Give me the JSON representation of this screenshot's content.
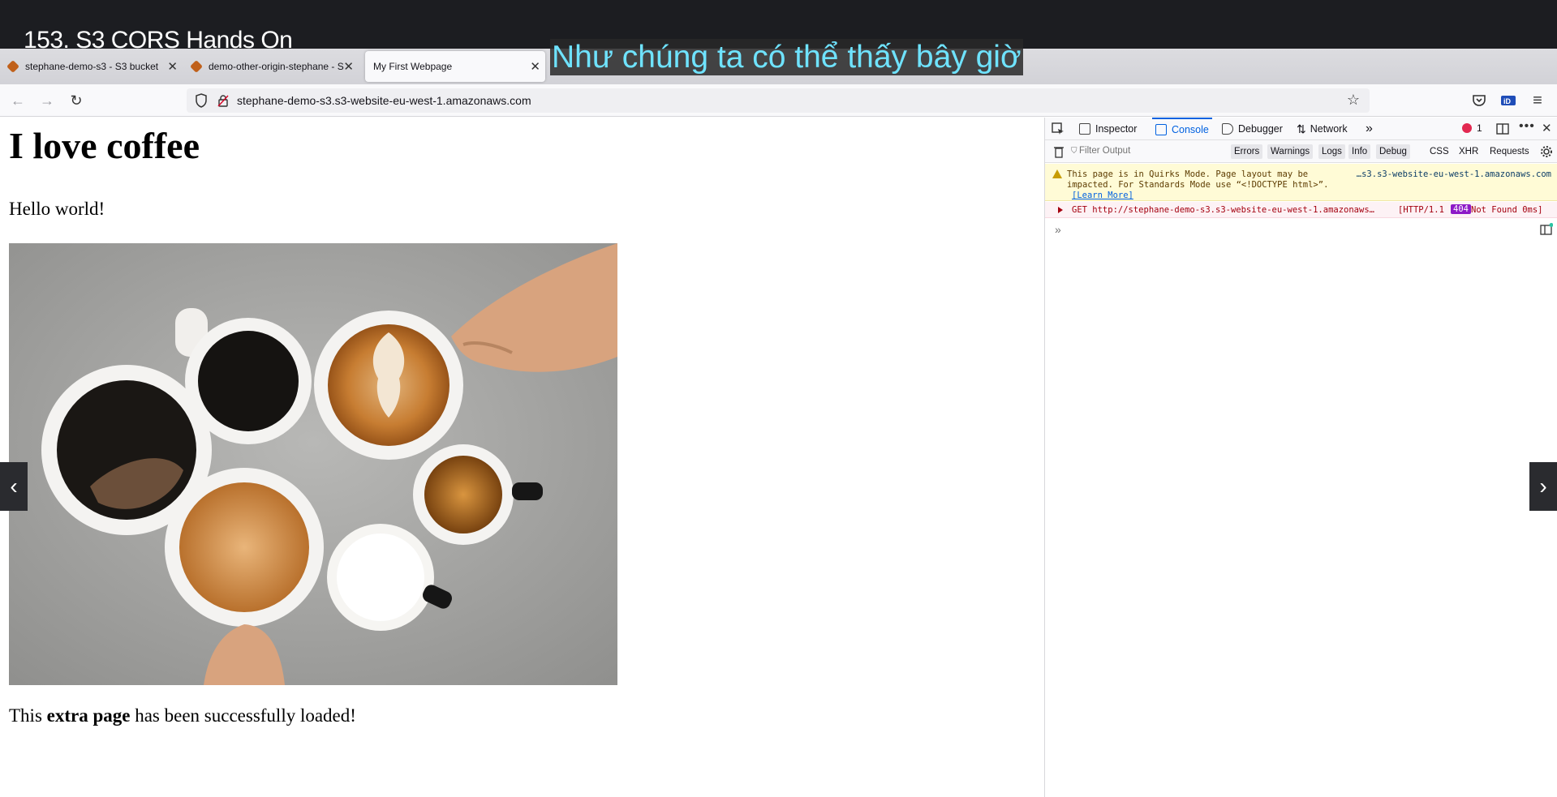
{
  "overlay": {
    "video_title": "153. S3 CORS Hands On",
    "subtitle": "Như chúng ta có thể thấy bây giờ"
  },
  "tabs": [
    {
      "label": "stephane-demo-s3 - S3 bucket",
      "close": "✕"
    },
    {
      "label": "demo-other-origin-stephane - S",
      "close": "✕"
    },
    {
      "label": "My First Webpage",
      "close": "✕"
    }
  ],
  "nav": {
    "back": "←",
    "forward": "→",
    "reload": "↻",
    "url": "stephane-demo-s3.s3-website-eu-west-1.amazonaws.com",
    "star": "☆",
    "menu": "≡"
  },
  "page": {
    "heading": "I love coffee",
    "hello": "Hello world!",
    "loaded_prefix": "This ",
    "loaded_bold": "extra page",
    "loaded_suffix": " has been successfully loaded!"
  },
  "side_arrows": {
    "left": "‹",
    "right": "›"
  },
  "devtools": {
    "tabs": [
      "Inspector",
      "Console",
      "Debugger",
      "Network"
    ],
    "more": "»",
    "error_count": "1",
    "filter_placeholder": "Filter Output",
    "filter_buttons": [
      "Errors",
      "Warnings",
      "Logs",
      "Info",
      "Debug"
    ],
    "filter_plain": [
      "CSS",
      "XHR",
      "Requests"
    ],
    "warning": {
      "line1": "This page is in Quirks Mode. Page layout may be",
      "line2": "impacted. For Standards Mode use “<!DOCTYPE html>”.",
      "link": "[Learn More]",
      "source": "…s3.s3-website-eu-west-1.amazonaws.com"
    },
    "error": {
      "request": "GET http://stephane-demo-s3.s3-website-eu-west-1.amazonaws…",
      "http": "[HTTP/1.1",
      "code": "404",
      "status": "Not Found 0ms]"
    },
    "prompt": "»"
  },
  "colors": {
    "accent": "#0061e0",
    "subtitle": "#6fe3ff",
    "error_badge": "#8d1ac7",
    "warning_bg": "#fffbd6"
  }
}
